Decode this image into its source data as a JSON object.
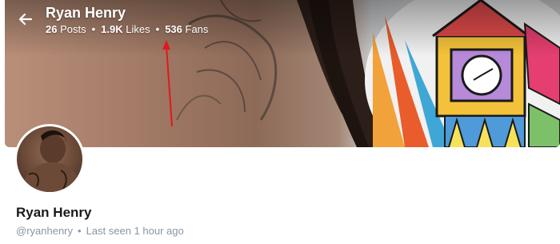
{
  "header": {
    "title": "Ryan Henry",
    "stats": {
      "posts_value": "26",
      "posts_label": "Posts",
      "likes_value": "1.9K",
      "likes_label": "Likes",
      "fans_value": "536",
      "fans_label": "Fans",
      "separator": "•"
    }
  },
  "profile": {
    "name": "Ryan Henry",
    "handle": "@ryanhenry",
    "separator": "•",
    "last_seen": "Last seen 1 hour ago"
  },
  "icons": {
    "back": "arrow-left-icon"
  },
  "colors": {
    "annotation_arrow": "#e0191b",
    "muted_text": "#8a96a3"
  }
}
